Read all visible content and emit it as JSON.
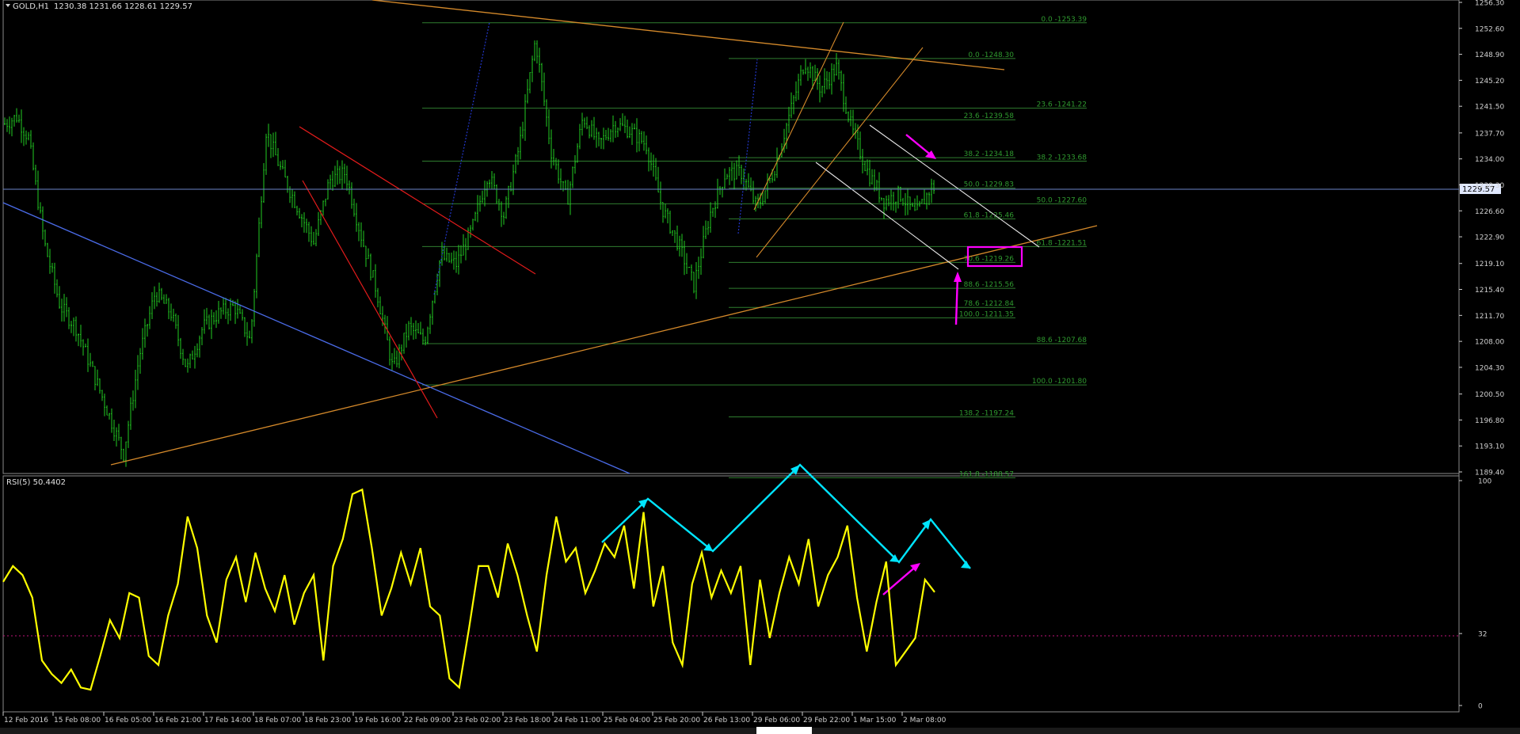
{
  "header": {
    "symbol_title": "GOLD,H1",
    "ohlc": "1230.38 1231.66 1228.61 1229.57",
    "rsi_title": "RSI(5) 50.4402"
  },
  "colors": {
    "background": "#000000",
    "candles": "#22cc22",
    "rsi_line": "#ffff00",
    "fib_lines": "#2f7d2f",
    "fib_labels": "#2f9a2f",
    "orange_lines": "#d4892a",
    "blue_line": "#4a6be8",
    "red_lines": "#e11b1b",
    "white_channel": "#e8e8e8",
    "magenta": "#ff00ff",
    "cyan": "#00e5ff",
    "axis_text": "#d0d0d0",
    "price_marker": "#9fb5e0"
  },
  "price_axis": {
    "labels": [
      "1256.30",
      "1252.60",
      "1248.90",
      "1245.20",
      "1241.50",
      "1237.70",
      "1234.00",
      "1230.30",
      "1226.60",
      "1222.90",
      "1219.10",
      "1215.40",
      "1211.70",
      "1208.00",
      "1204.30",
      "1200.50",
      "1196.80",
      "1193.10",
      "1189.40"
    ],
    "current_price": "1229.57"
  },
  "rsi_axis": {
    "labels": [
      "100",
      "32",
      "0"
    ],
    "level": 32
  },
  "time_axis": {
    "labels": [
      "12 Feb 2016",
      "15 Feb 08:00",
      "16 Feb 05:00",
      "16 Feb 21:00",
      "17 Feb 14:00",
      "18 Feb 07:00",
      "18 Feb 23:00",
      "19 Feb 16:00",
      "22 Feb 09:00",
      "23 Feb 02:00",
      "23 Feb 18:00",
      "24 Feb 11:00",
      "25 Feb 04:00",
      "25 Feb 20:00",
      "26 Feb 13:00",
      "29 Feb 06:00",
      "29 Feb 22:00",
      "1 Mar 15:00",
      "2 Mar 08:00"
    ]
  },
  "fib_set_a": [
    {
      "level": "0.0",
      "price": "1253.39"
    },
    {
      "level": "23.6",
      "price": "1241.22"
    },
    {
      "level": "38.2",
      "price": "1233.68"
    },
    {
      "level": "50.0",
      "price": "1227.60"
    },
    {
      "level": "61.8",
      "price": "1221.51"
    },
    {
      "level": "88.6",
      "price": "1207.68"
    },
    {
      "level": "100.0",
      "price": "1201.80"
    }
  ],
  "fib_set_b": [
    {
      "level": "0.0",
      "price": "1248.30"
    },
    {
      "level": "23.6",
      "price": "1239.58"
    },
    {
      "level": "38.2",
      "price": "1234.18"
    },
    {
      "level": "50.0",
      "price": "1229.83"
    },
    {
      "level": "61.8",
      "price": "1225.46"
    },
    {
      "level": "70.6",
      "price": "1219.26"
    },
    {
      "level": "88.6",
      "price": "1215.56"
    },
    {
      "level": "78.6",
      "price": "1212.84"
    },
    {
      "level": "100.0",
      "price": "1211.35"
    },
    {
      "level": "138.2",
      "price": "1197.24"
    },
    {
      "level": "161.8",
      "price": "1188.57"
    }
  ],
  "chart_data": [
    {
      "type": "candlestick",
      "title": "GOLD,H1",
      "timeframe": "H1",
      "last_bar": {
        "open": 1230.38,
        "high": 1231.66,
        "low": 1228.61,
        "close": 1229.57
      },
      "ylim": [
        1189.4,
        1258.0
      ],
      "x_tick_labels": [
        "12 Feb 2016",
        "15 Feb 08:00",
        "16 Feb 05:00",
        "16 Feb 21:00",
        "17 Feb 14:00",
        "18 Feb 07:00",
        "18 Feb 23:00",
        "19 Feb 16:00",
        "22 Feb 09:00",
        "23 Feb 02:00",
        "23 Feb 18:00",
        "24 Feb 11:00",
        "25 Feb 04:00",
        "25 Feb 20:00",
        "26 Feb 13:00",
        "29 Feb 06:00",
        "29 Feb 22:00",
        "1 Mar 15:00",
        "2 Mar 08:00"
      ],
      "approx_close_path": {
        "note_free_points": true,
        "x": [
          0,
          15,
          30,
          50,
          70,
          90,
          110,
          130,
          150,
          170,
          190,
          210,
          230,
          250,
          270,
          290,
          310,
          330,
          350,
          370,
          390,
          410,
          430,
          450,
          470,
          490,
          510,
          530,
          550,
          570,
          590,
          610,
          630,
          650,
          670,
          690,
          710,
          730,
          750,
          770,
          790,
          810,
          830,
          850,
          870,
          890,
          910,
          930,
          950,
          970,
          990,
          1010,
          1030,
          1050,
          1070,
          1090,
          1110,
          1130,
          1150,
          1170,
          1185
        ],
        "close": [
          1239,
          1240,
          1237,
          1222,
          1213,
          1210,
          1204,
          1198,
          1192,
          1206,
          1215,
          1212,
          1204,
          1210,
          1212,
          1213,
          1208,
          1238,
          1232,
          1227,
          1222,
          1231,
          1232,
          1223,
          1215,
          1204,
          1210,
          1208,
          1220,
          1219,
          1224,
          1232,
          1226,
          1236,
          1251,
          1235,
          1228,
          1240,
          1236,
          1239,
          1238,
          1236,
          1227,
          1222,
          1216,
          1226,
          1232,
          1232,
          1227,
          1232,
          1240,
          1248,
          1244,
          1247,
          1238,
          1232,
          1228,
          1229,
          1226,
          1230,
          1229.6
        ]
      }
    },
    {
      "type": "line",
      "title": "RSI(5) 50.4402",
      "ylim": [
        0,
        100
      ],
      "level_line": 32,
      "x": [
        0,
        10,
        20,
        30,
        40,
        50,
        60,
        70,
        80,
        90,
        100,
        110,
        120,
        130,
        140,
        150,
        160,
        170,
        180,
        190,
        200,
        210,
        220,
        230,
        240,
        250,
        260,
        270,
        280,
        290,
        300,
        310,
        320,
        330,
        340,
        350,
        360,
        370,
        380,
        390,
        400,
        410,
        420,
        430,
        440,
        450,
        460,
        470,
        480,
        490,
        500,
        510,
        520,
        530,
        540,
        550,
        560,
        570,
        580,
        590,
        600,
        610,
        620,
        630,
        640,
        650,
        660,
        670,
        680,
        690,
        700,
        710,
        720,
        730,
        740,
        750,
        760,
        770,
        780,
        790,
        800,
        810,
        820,
        830,
        840,
        850,
        860,
        870,
        880,
        890,
        900,
        910,
        920,
        930,
        940,
        950,
        960
      ],
      "values": [
        55,
        62,
        58,
        48,
        20,
        14,
        10,
        16,
        8,
        7,
        22,
        38,
        30,
        50,
        48,
        22,
        18,
        40,
        54,
        84,
        70,
        40,
        28,
        56,
        66,
        46,
        68,
        52,
        42,
        58,
        36,
        50,
        58,
        20,
        62,
        74,
        94,
        96,
        70,
        40,
        52,
        68,
        54,
        70,
        44,
        40,
        12,
        8,
        34,
        62,
        62,
        48,
        72,
        58,
        40,
        24,
        58,
        84,
        64,
        70,
        50,
        60,
        72,
        66,
        80,
        52,
        86,
        44,
        62,
        28,
        18,
        54,
        68,
        48,
        60,
        50,
        62,
        18,
        56,
        30,
        50,
        66,
        54,
        74,
        44,
        58,
        66,
        80,
        48,
        24,
        46,
        64,
        18,
        24,
        30,
        56,
        50.44
      ]
    }
  ],
  "annotations": {
    "rsi_zigzag_cyan": "three-wave up / down pattern drawn on RSI",
    "target_box": "magenta box near 1219.26"
  }
}
